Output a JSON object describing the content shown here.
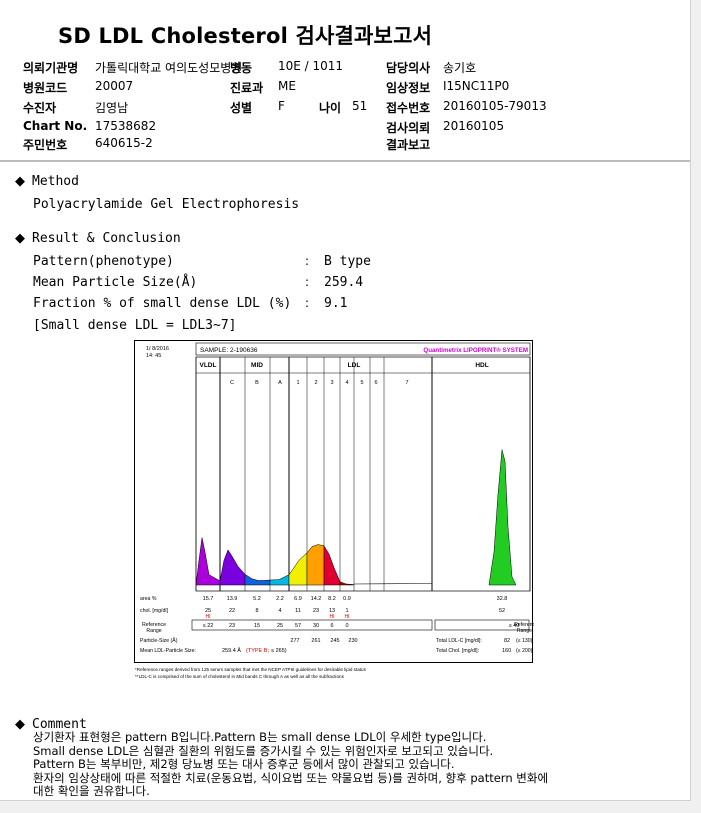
{
  "title": "SD LDL Cholesterol 검사결과보고서",
  "header": {
    "requesting_dept_label": "의뢰기관명",
    "requesting_dept_value": "가톨릭대학교 여의도성모병원",
    "ward_label": "병동",
    "ward_value": "10E / 1011",
    "doctor_label": "담당의사",
    "doctor_value": "송기호",
    "hospital_code_label": "병원코드",
    "hospital_code_value": "20007",
    "department_label": "진료과",
    "department_value": "ME",
    "clinical_info_label": "임상정보",
    "clinical_info_value": "I15NC11P0",
    "patient_label": "수진자",
    "patient_value": "김영남",
    "sex_label": "성별",
    "sex_value": "F",
    "age_label": "나이",
    "age_value": "51",
    "receipt_no_label": "접수번호",
    "receipt_no_value": "20160105-79013",
    "chart_no_label": "Chart No.",
    "chart_no_value": "17538682",
    "request_date_label": "검사의뢰",
    "request_date_value": "20160105",
    "resident_no_label": "주민번호",
    "resident_no_value": "640615-2",
    "report_label": "결과보고",
    "report_value": ""
  },
  "method": {
    "heading": "Method",
    "text": "Polyacrylamide Gel Electrophoresis"
  },
  "result": {
    "heading": "Result & Conclusion",
    "rows": [
      {
        "label": "Pattern(phenotype)",
        "value": "B type"
      },
      {
        "label": "Mean Particle Size(Å)",
        "value": "259.4"
      },
      {
        "label": "Fraction % of small dense LDL (%)",
        "value": "9.1"
      }
    ],
    "note": "[Small dense LDL = LDL3~7]"
  },
  "chart_data": {
    "type": "area",
    "date": "1/ 8/2016",
    "time": "14: 45",
    "sample": "SAMPLE:   2-190636",
    "brand": "Quantimetrix LIPOPRINT® SYSTEM",
    "groups": [
      "VLDL",
      "MID",
      "LDL",
      "HDL"
    ],
    "bands": [
      "VLDL",
      "C",
      "B",
      "A",
      "1",
      "2",
      "3",
      "4",
      "5",
      "6",
      "7",
      "HDL"
    ],
    "area_pct_label": "area %",
    "area_pct": [
      "15.7",
      "13.9",
      "5.2",
      "2.2",
      "6.9",
      "14.2",
      "8.2",
      "0.9",
      "",
      "",
      "",
      "32.8"
    ],
    "chol_label": "chol. [mg/dl]",
    "chol": [
      "25",
      "22",
      "8",
      "4",
      "11",
      "23",
      "13",
      "1",
      "",
      "",
      "",
      "52"
    ],
    "chol_flags": [
      "HI",
      "",
      "",
      "",
      "",
      "",
      "HI",
      "HI",
      "",
      "",
      "",
      ""
    ],
    "reference_label": "Reference Range",
    "reference": [
      "≤ 22",
      "23",
      "15",
      "25",
      "57",
      "30",
      "6",
      "0",
      "",
      "",
      "",
      "≥ 40"
    ],
    "particle_size_label": "Particle-Size (Å)",
    "particle_size": [
      "",
      "",
      "",
      "",
      "277",
      "261",
      "245",
      "230",
      "",
      "",
      "",
      ""
    ],
    "mean_size_label": "Mean LDL-Particle Size:",
    "mean_size_value": "259.4 Å",
    "mean_size_type": "(TYPE B",
    "mean_size_ref": "; ≤ 265)",
    "total_ldl_label": "Total LDL-C [mg/dl]:",
    "total_ldl_value": "82",
    "total_ldl_ref": "(≤ 130)",
    "total_chol_label": "Total Chol. [mg/dl]:",
    "total_chol_value": "160",
    "total_chol_ref": "(≤ 200)",
    "footnote1": "*Reference ranges derived from 125 serum samples that met the NCEP ATPIII guidelines for desirable lipid status",
    "footnote2": "**LDL-C is comprised of the sum of cholesterol in Mid bands C through A as well as all the subfractions"
  },
  "comment": {
    "heading": "Comment",
    "lines": [
      "상기환자 표현형은 pattern B입니다.Pattern B는 small dense LDL이 우세한 type입니다.",
      "Small dense LDL은 심혈관 질환의 위험도를 증가시킬 수 있는 위험인자로 보고되고 있습니다.",
      "Pattern B는 복부비만, 제2형 당뇨병 또는 대사 증후군 등에서 많이 관찰되고 있습니다.",
      "환자의 임상상태에 따른 적절한 치료(운동요법, 식이요법 또는 약물요법 등)를 권하며, 향후 pattern 변화에",
      "대한 확인을 권유합니다."
    ]
  },
  "colors": {
    "accent_purple": "#cc00cc",
    "type_red": "#e00000",
    "hdl_green": "#22cc22"
  }
}
